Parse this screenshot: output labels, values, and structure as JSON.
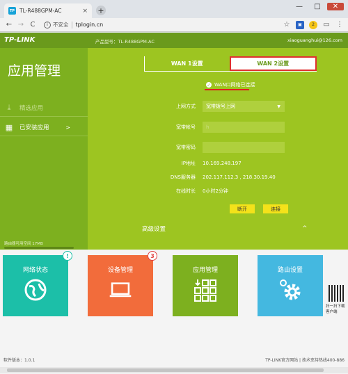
{
  "browser": {
    "tab_title": "TL-R488GPM-AC",
    "favicon_text": "TP",
    "tab_close": "×",
    "new_tab": "+",
    "window_controls": [
      "—",
      "□",
      "✕"
    ],
    "nav_back": "←",
    "nav_forward": "→",
    "nav_reload": "C",
    "insecure_label": "不安全",
    "url": "tplogin.cn",
    "extension_badge": "2"
  },
  "header": {
    "logo": "TP-LINK",
    "model_label": "产品型号：TL-R488GPM-AC",
    "account": "xiaoguanghui@126.com"
  },
  "sidebar": {
    "title": "应用管理",
    "items": [
      {
        "label": "精选应用",
        "icon": "download-icon"
      },
      {
        "label": "已安装应用",
        "icon": "grid-icon",
        "arrow": ">"
      }
    ],
    "storage_text": "路由器可用空间 17MB",
    "storage_percent": 0
  },
  "wan": {
    "tabs": [
      "WAN 1设置",
      "WAN 2设置"
    ],
    "active_tab": 1,
    "status": "WAN口网络已连接",
    "fields": {
      "mode_label": "上网方式",
      "mode_value": "宽带拨号上网",
      "account_label": "宽带帐号",
      "account_value": "h",
      "password_label": "宽带密码",
      "password_value": "",
      "ip_label": "IP地址",
      "ip_value": "10.169.248.197",
      "dns_label": "DNS服务器",
      "dns_value": "202.117.112.3 , 218.30.19.40",
      "uptime_label": "在线时长",
      "uptime_value": "0小时2分钟"
    },
    "disconnect_button": "断开",
    "connect_button": "连接",
    "advanced": "高级设置",
    "advanced_caret": "^"
  },
  "tiles": [
    {
      "title": "网络状态",
      "icon": "globe-icon",
      "color": "#1cbfa8",
      "badge": "!"
    },
    {
      "title": "设备管理",
      "icon": "laptop-icon",
      "color": "#f26c3b",
      "badge": "3"
    },
    {
      "title": "应用管理",
      "icon": "apps-icon",
      "color": "#7db01f",
      "badge": ""
    },
    {
      "title": "路由设置",
      "icon": "gear-icon",
      "color": "#44b8e0",
      "badge": ""
    }
  ],
  "qr_text": "扫一扫下载客户端",
  "footer": {
    "version": "软件版本：1.0.1",
    "links": "TP-LINK官方网站 | 技术支持热线400-886"
  },
  "colors": {
    "topbar": "#6a9a1c",
    "sidebar": "#7db01f",
    "content": "#9dc521",
    "button": "#f4e21a",
    "highlight": "#e02020"
  }
}
